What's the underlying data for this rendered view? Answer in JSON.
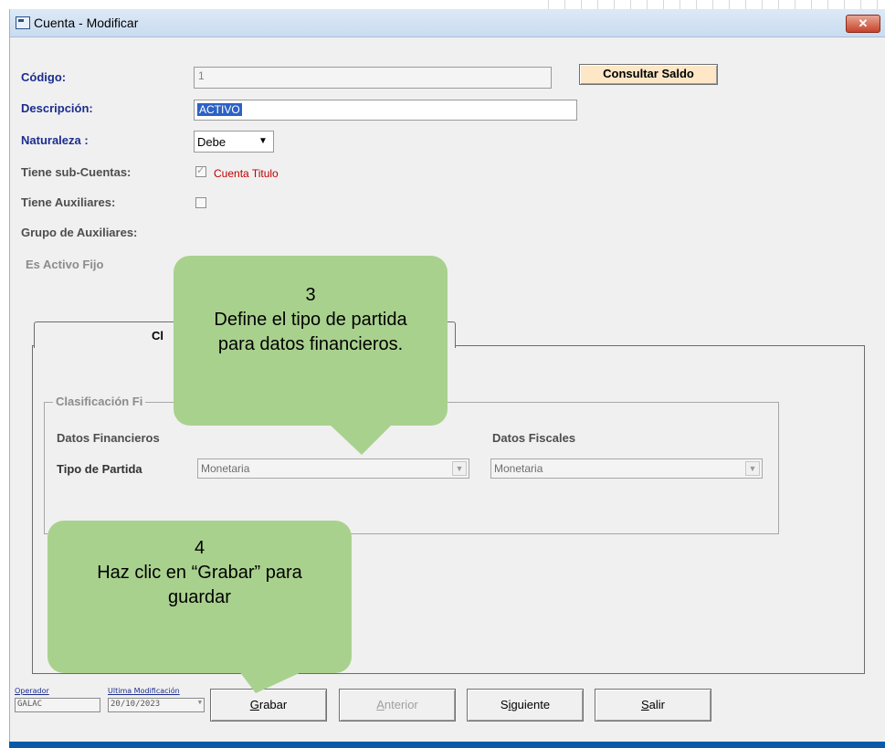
{
  "window": {
    "title": "Cuenta - Modificar",
    "close_label": "✕"
  },
  "form": {
    "codigo_label": "Código:",
    "codigo_value": "1",
    "consultar_saldo_label": "Consultar Saldo",
    "descripcion_label": "Descripción:",
    "descripcion_value": "ACTIVO",
    "naturaleza_label": "Naturaleza :",
    "naturaleza_value": "Debe",
    "tiene_subcuentas_label": "Tiene sub-Cuentas:",
    "tiene_subcuentas_checked": true,
    "cuenta_titulo_label": "Cuenta Titulo",
    "tiene_auxiliares_label": "Tiene Auxiliares:",
    "tiene_auxiliares_checked": false,
    "grupo_auxiliares_label": "Grupo de Auxiliares:",
    "es_activo_fijo_label": "Es Activo Fijo"
  },
  "tabs": {
    "active_tab_label": "Cl"
  },
  "clasificacion": {
    "group_label": "Clasificación Fi",
    "datos_financieros_label": "Datos Financieros",
    "datos_fiscales_label": "Datos Fiscales",
    "tipo_partida_label": "Tipo de Partida",
    "tipo_partida_financiero_value": "Monetaria",
    "tipo_partida_fiscal_value": "Monetaria"
  },
  "footer": {
    "operador_label": "Operador",
    "operador_value": "GALAC",
    "ultima_mod_label": "Ultima Modificación",
    "ultima_mod_value": "20/10/2023",
    "grabar_label": "Grabar",
    "anterior_label": "Anterior",
    "siguiente_label": "Siguiente",
    "salir_label": "Salir"
  },
  "callouts": {
    "step3_number": "3",
    "step3_text": "Define el tipo de partida para datos financieros.",
    "step4_number": "4",
    "step4_text": "Haz clic en “Grabar” para guardar"
  },
  "colors": {
    "callout_fill": "#a9d18e",
    "label_blue": "#1b2d8f",
    "title_bar": "#c9dcf0",
    "cuenta_titulo_red": "#c00000"
  }
}
